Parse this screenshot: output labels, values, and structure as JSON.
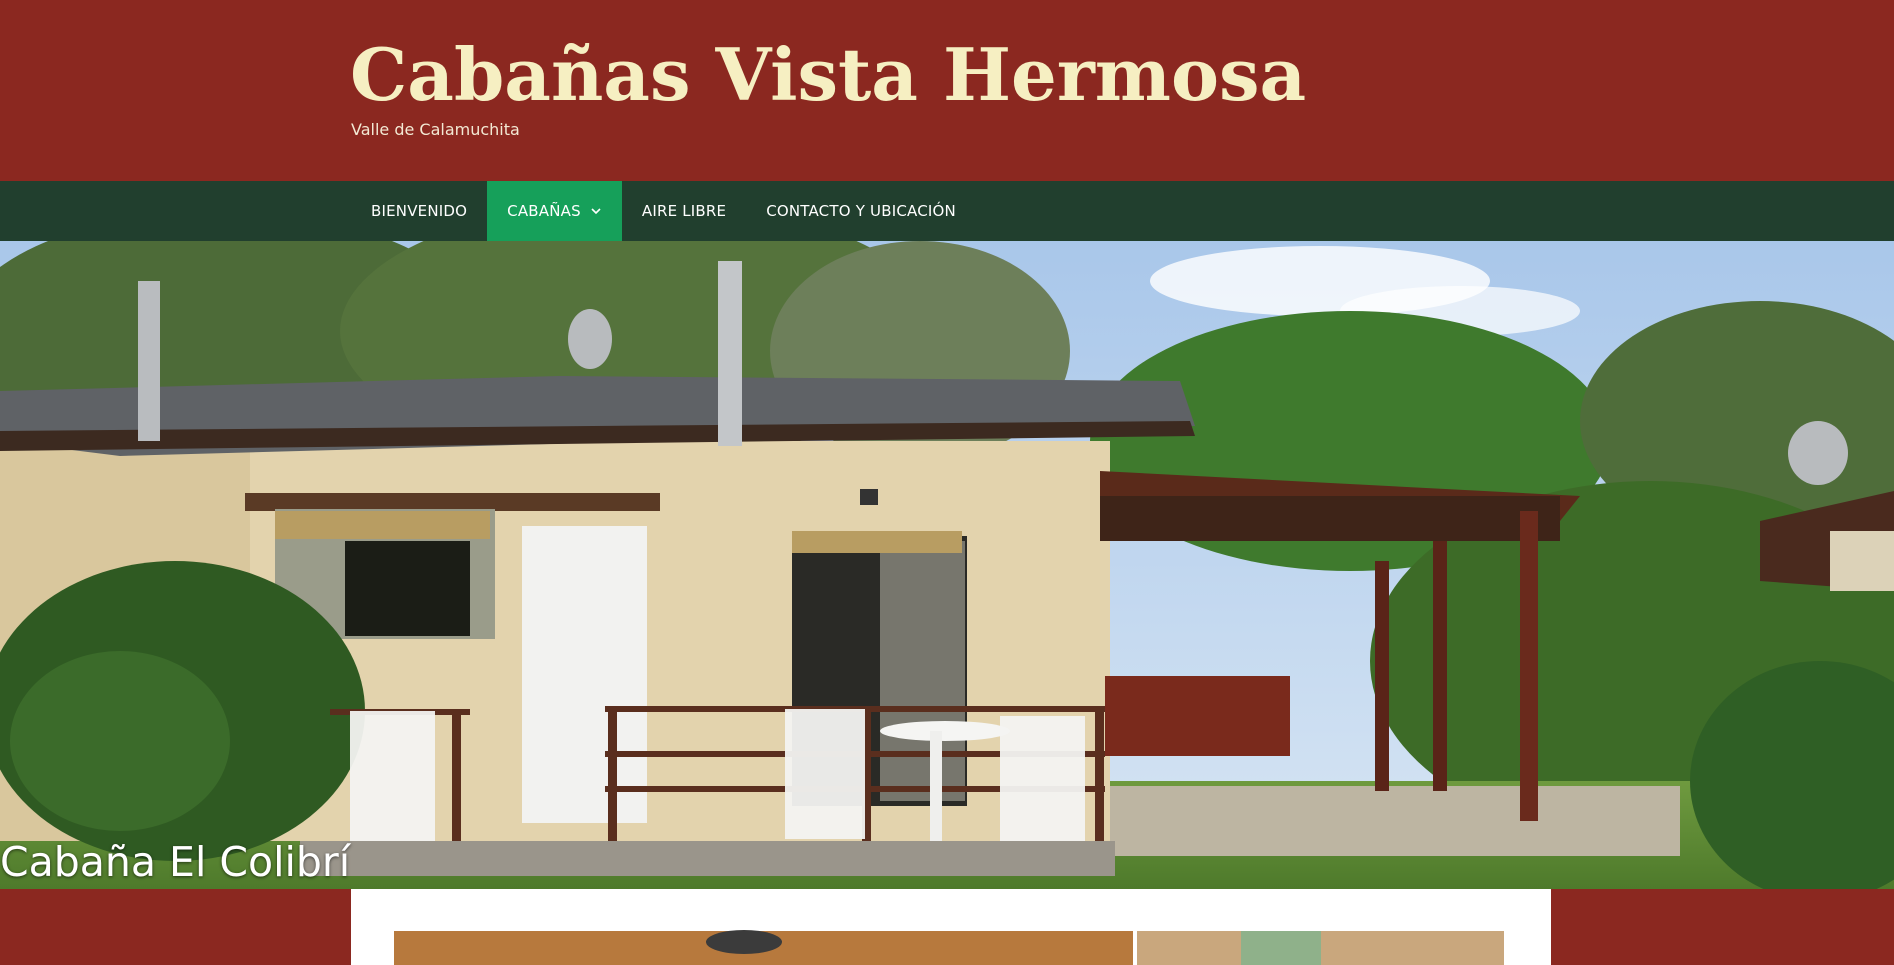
{
  "site": {
    "title": "Cabañas Vista Hermosa",
    "tagline": "Valle de Calamuchita"
  },
  "nav": {
    "items": [
      {
        "label": "BIENVENIDO"
      },
      {
        "label": "CABAÑAS",
        "has_dropdown": true,
        "active": true
      },
      {
        "label": "AIRE LIBRE"
      },
      {
        "label": "CONTACTO Y UBICACIÓN"
      }
    ],
    "chevron_icon": "chevron-down-icon"
  },
  "hero": {
    "caption": "Cabaña El Colibrí"
  },
  "colors": {
    "header_bg": "#8b2820",
    "title_color": "#f6efc2",
    "nav_bg": "#213f2e",
    "nav_active": "#16a05a",
    "content_bg": "#ffffff"
  }
}
